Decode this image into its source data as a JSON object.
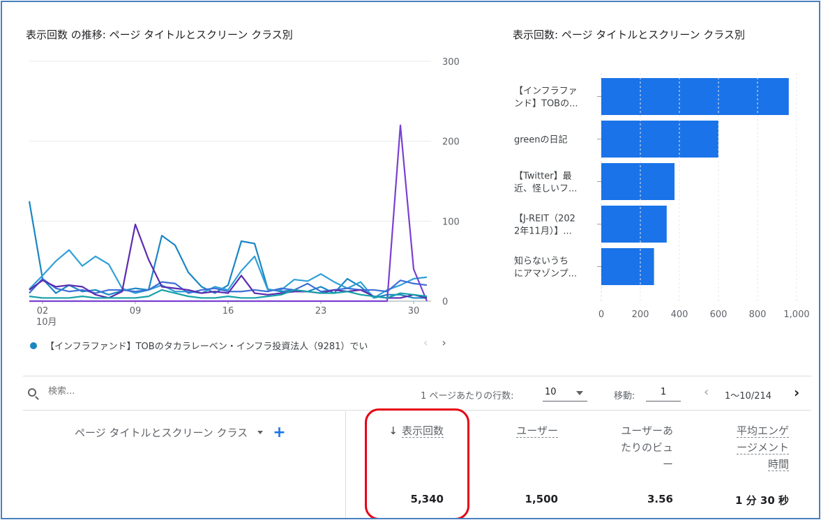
{
  "line_chart": {
    "title": "表示回数 の推移: ページ タイトルとスクリーン クラス別",
    "y_ticks": [
      "300",
      "200",
      "100",
      "0"
    ],
    "x_ticks": [
      "02",
      "09",
      "16",
      "23",
      "30"
    ],
    "x_month": "10月",
    "legend_text": "【インフラファンド】TOBのタカラレーベン・インフラ投資法人（9281）でい",
    "series_colors": [
      "#1a86c4",
      "#2f9fd8",
      "#3d6fd6",
      "#7b3fd1",
      "#5b2bb0",
      "#15a0a8"
    ]
  },
  "bar_chart": {
    "title": "表示回数: ページ タイトルとスクリーン クラス別",
    "labels": [
      [
        "【インフラファ",
        "ンド】TOBの..."
      ],
      [
        "greenの日記"
      ],
      [
        "【Twitter】最",
        "近、怪しいフ..."
      ],
      [
        "【J-REIT（202",
        "2年11月）】..."
      ],
      [
        "知らないうち",
        "にアマゾンプ..."
      ]
    ],
    "x_ticks": [
      "0",
      "200",
      "400",
      "600",
      "800",
      "1,000"
    ],
    "bar_color": "#1a73e8"
  },
  "chart_data": [
    {
      "type": "line",
      "title": "表示回数 の推移: ページ タイトルとスクリーン クラス別",
      "x": [
        1,
        2,
        3,
        4,
        5,
        6,
        7,
        8,
        9,
        10,
        11,
        12,
        13,
        14,
        15,
        16,
        17,
        18,
        19,
        20,
        21,
        22,
        23,
        24,
        25,
        26,
        27,
        28,
        29,
        30,
        31
      ],
      "x_ticks": [
        "02",
        "09",
        "16",
        "23",
        "30"
      ],
      "ylim": [
        0,
        300
      ],
      "series": [
        {
          "name": "【インフラファンド】TOBのタカラレーベン・インフラ投資法人（9281）でい",
          "values": [
            125,
            28,
            10,
            20,
            12,
            14,
            8,
            13,
            16,
            14,
            82,
            70,
            36,
            18,
            10,
            20,
            75,
            72,
            15,
            12,
            14,
            12,
            18,
            10,
            28,
            18,
            4,
            8,
            8,
            4,
            4
          ]
        },
        {
          "values": [
            15,
            32,
            50,
            64,
            44,
            56,
            46,
            16,
            10,
            14,
            20,
            12,
            12,
            10,
            18,
            14,
            38,
            56,
            14,
            14,
            27,
            25,
            34,
            24,
            16,
            24,
            4,
            14,
            20,
            28,
            30
          ]
        },
        {
          "values": [
            10,
            28,
            16,
            12,
            14,
            10,
            14,
            14,
            12,
            14,
            24,
            22,
            10,
            14,
            16,
            12,
            12,
            14,
            12,
            16,
            14,
            22,
            12,
            14,
            16,
            14,
            14,
            12,
            26,
            22,
            20
          ]
        },
        {
          "values": [
            0,
            0,
            0,
            0,
            0,
            0,
            0,
            0,
            0,
            0,
            0,
            0,
            0,
            0,
            0,
            0,
            0,
            0,
            0,
            0,
            0,
            0,
            0,
            0,
            0,
            0,
            0,
            0,
            220,
            40,
            0
          ]
        },
        {
          "values": [
            14,
            26,
            18,
            20,
            18,
            8,
            4,
            12,
            96,
            52,
            18,
            16,
            14,
            10,
            12,
            10,
            32,
            10,
            8,
            10,
            12,
            12,
            10,
            14,
            12,
            14,
            6,
            4,
            4,
            8,
            4
          ]
        },
        {
          "values": [
            6,
            4,
            4,
            4,
            6,
            4,
            4,
            4,
            4,
            6,
            14,
            10,
            6,
            4,
            4,
            6,
            4,
            4,
            6,
            8,
            14,
            12,
            10,
            10,
            12,
            8,
            6,
            4,
            10,
            8,
            6
          ]
        }
      ]
    },
    {
      "type": "bar",
      "title": "表示回数: ページ タイトルとスクリーン クラス別",
      "categories": [
        "【インフラファンド】TOBの...",
        "greenの日記",
        "【Twitter】最近、怪しいフ...",
        "【J-REIT（2022年11月）】...",
        "知らないうちにアマゾンプ..."
      ],
      "values": [
        960,
        600,
        375,
        335,
        270
      ],
      "xlim": [
        0,
        1000
      ],
      "x_ticks": [
        "0",
        "200",
        "400",
        "600",
        "800",
        "1,000"
      ]
    }
  ],
  "toolbar": {
    "search_placeholder": "検索...",
    "rows_label": "1 ページあたりの行数:",
    "rows_value": "10",
    "goto_label": "移動:",
    "goto_value": "1",
    "page_range": "1〜10/214",
    "prev_icon": "‹",
    "next_icon": "›"
  },
  "table": {
    "dimension_header": "ページ タイトルとスクリーン クラス",
    "add_icon": "+",
    "sort_icon": "↓",
    "metrics": [
      {
        "lines": [
          "表示回数"
        ],
        "value": "5,340"
      },
      {
        "lines": [
          "ユーザー"
        ],
        "value": "1,500"
      },
      {
        "lines": [
          "ユーザーあ",
          "たりのビュ",
          "ー"
        ],
        "value": "3.56"
      },
      {
        "lines": [
          "平均エンゲ",
          "ージメント",
          "時間"
        ],
        "value": "1 分 30 秒"
      }
    ]
  }
}
